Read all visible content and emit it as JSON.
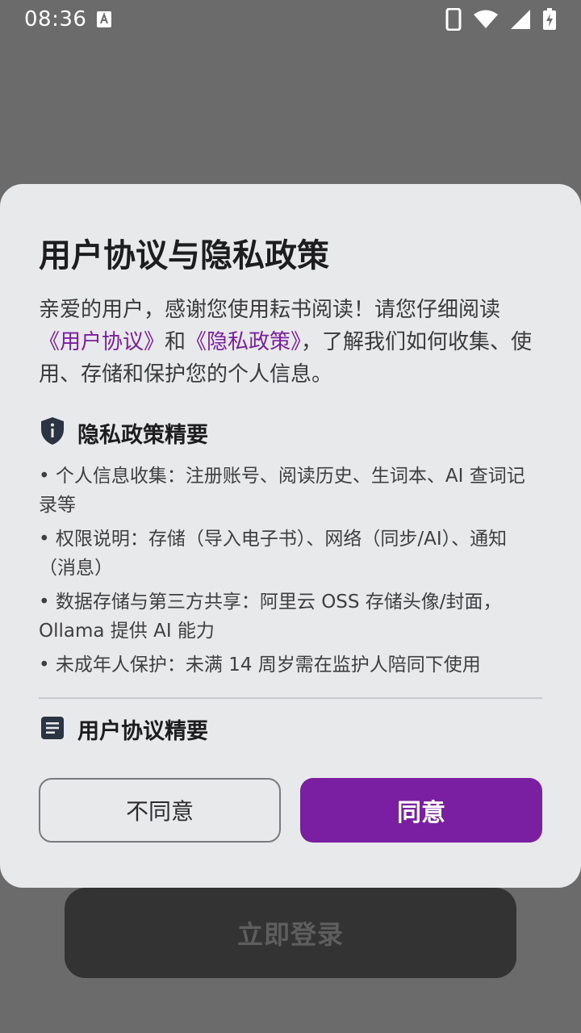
{
  "status_bar": {
    "time": "08:36",
    "icons": [
      "notification-a-icon",
      "phone-icon",
      "wifi-icon",
      "signal-icon",
      "battery-charging-icon"
    ]
  },
  "background": {
    "login_button_label": "立即登录"
  },
  "dialog": {
    "title": "用户协议与隐私政策",
    "intro": {
      "part1": "亲爱的用户，感谢您使用耘书阅读！请您仔细阅读",
      "link_terms": "《用户协议》",
      "and": "和",
      "link_privacy": "《隐私政策》",
      "part2": "，了解我们如何收集、使用、存储和保护您的个人信息。"
    },
    "privacy_section": {
      "title": "隐私政策精要",
      "icon": "shield-info-icon",
      "bullets": [
        "• 个人信息收集：注册账号、阅读历史、生词本、AI 查词记录等",
        "• 权限说明：存储（导入电子书）、网络（同步/AI）、通知（消息）",
        "• 数据存储与第三方共享：阿里云 OSS 存储头像/封面，Ollama 提供 AI 能力",
        "• 未成年人保护：未满 14 周岁需在监护人陪同下使用"
      ]
    },
    "terms_section": {
      "title": "用户协议精要",
      "icon": "document-icon"
    },
    "buttons": {
      "disagree": "不同意",
      "agree": "同意"
    }
  },
  "colors": {
    "accent": "#7b1fa2",
    "dialog_bg": "#e8e9eb",
    "scrim": "#6b6b6b"
  }
}
